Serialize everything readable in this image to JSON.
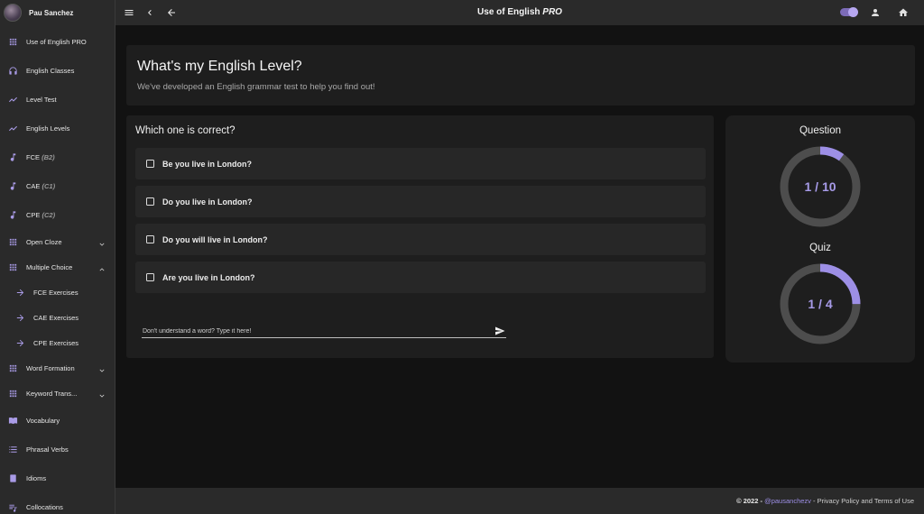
{
  "profile": {
    "name": "Pau Sanchez"
  },
  "sidebar": {
    "items": [
      {
        "label": "Use of English PRO",
        "level": "",
        "icon": "grid-icon"
      },
      {
        "label": "English Classes",
        "level": "",
        "icon": "headphones-icon"
      },
      {
        "label": "Level Test",
        "level": "",
        "icon": "trend-line-icon"
      },
      {
        "label": "English Levels",
        "level": "",
        "icon": "trend-line-icon"
      },
      {
        "label": "FCE",
        "level": "(B2)",
        "icon": "music-note-icon"
      },
      {
        "label": "CAE",
        "level": "(C1)",
        "icon": "music-note-icon"
      },
      {
        "label": "CPE",
        "level": "(C2)",
        "icon": "music-note-icon"
      },
      {
        "label": "Open Cloze",
        "level": "",
        "icon": "grid-icon",
        "expand": "chevron-down-icon"
      },
      {
        "label": "Multiple Choice",
        "level": "",
        "icon": "grid-icon",
        "expand": "chevron-up-icon"
      },
      {
        "label": "FCE Exercises",
        "level": "",
        "icon": "arrow-right-icon"
      },
      {
        "label": "CAE Exercises",
        "level": "",
        "icon": "arrow-right-icon"
      },
      {
        "label": "CPE Exercises",
        "level": "",
        "icon": "arrow-right-icon"
      },
      {
        "label": "Word Formation",
        "level": "",
        "icon": "grid-icon",
        "expand": "chevron-down-icon"
      },
      {
        "label": "Keyword Trans...",
        "level": "",
        "icon": "grid-icon",
        "expand": "chevron-down-icon"
      },
      {
        "label": "Vocabulary",
        "level": "",
        "icon": "book-icon"
      },
      {
        "label": "Phrasal Verbs",
        "level": "",
        "icon": "list-icon"
      },
      {
        "label": "Idioms",
        "level": "",
        "icon": "notebook-icon"
      },
      {
        "label": "Collocations",
        "level": "",
        "icon": "playlist-icon"
      }
    ]
  },
  "topbar": {
    "title": "Use of English",
    "title_suffix": "PRO",
    "icons": [
      "menu-icon",
      "chevron-left-icon",
      "arrow-back-icon",
      "theme-toggle",
      "person-icon",
      "home-icon"
    ],
    "theme_dark_on": true
  },
  "hero": {
    "title": "What's my English Level?",
    "subtitle": "We've developed an English grammar test to help you find out!"
  },
  "question": {
    "prompt": "Which one is correct?",
    "options": [
      "Be you live in London?",
      "Do you live in London?",
      "Do you will live in London?",
      "Are you live in London?"
    ],
    "input_placeholder": "Don't understand a word? Type it here!"
  },
  "progress": {
    "question_label": "Question",
    "question_current": 1,
    "question_total": 10,
    "question_text": "1 / 10",
    "quiz_label": "Quiz",
    "quiz_current": 1,
    "quiz_total": 4,
    "quiz_text": "1 / 4"
  },
  "colors": {
    "accent": "#9d8fe6",
    "ring_track": "#4d4d4d",
    "sidebar_icon": "#a99be6"
  },
  "footer": {
    "copyright": "© 2022 -",
    "handle": "@pausanchezv",
    "separator": "-",
    "link": "Privacy Policy and Terms of Use"
  }
}
